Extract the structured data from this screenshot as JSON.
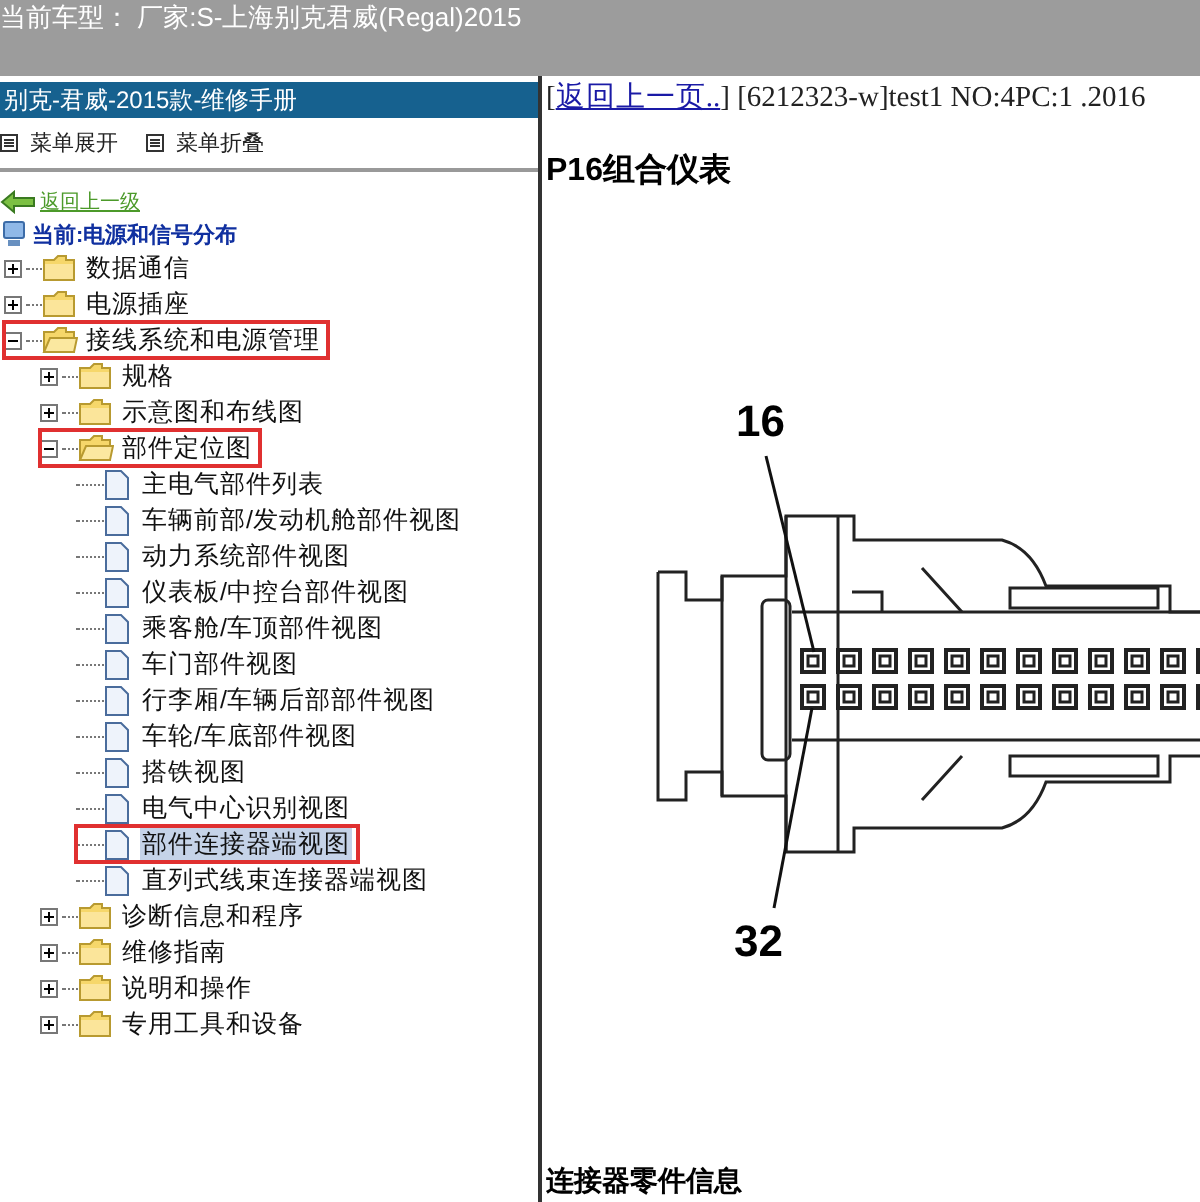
{
  "header": {
    "title": "当前车型： 厂家:S-上海别克君威(Regal)2015"
  },
  "sidebar": {
    "title": "别克-君威-2015款-维修手册",
    "menu_actions": [
      {
        "label": "菜单展开"
      },
      {
        "label": "菜单折叠"
      }
    ],
    "back_link": "返回上一级",
    "current": "当前:电源和信号分布",
    "tree": [
      {
        "label": "数据通信",
        "kind": "folder",
        "expanded": false,
        "selected": false,
        "highlighted": false
      },
      {
        "label": "电源插座",
        "kind": "folder",
        "expanded": false,
        "selected": false,
        "highlighted": false
      },
      {
        "label": "接线系统和电源管理",
        "kind": "folder",
        "expanded": true,
        "selected": false,
        "highlighted": true,
        "children": [
          {
            "label": "规格",
            "kind": "folder",
            "expanded": false,
            "selected": false,
            "highlighted": false
          },
          {
            "label": "示意图和布线图",
            "kind": "folder",
            "expanded": false,
            "selected": false,
            "highlighted": false
          },
          {
            "label": "部件定位图",
            "kind": "folder",
            "expanded": true,
            "selected": false,
            "highlighted": true,
            "children": [
              {
                "label": "主电气部件列表",
                "kind": "page",
                "selected": false,
                "highlighted": false
              },
              {
                "label": "车辆前部/发动机舱部件视图",
                "kind": "page",
                "selected": false,
                "highlighted": false
              },
              {
                "label": "动力系统部件视图",
                "kind": "page",
                "selected": false,
                "highlighted": false
              },
              {
                "label": "仪表板/中控台部件视图",
                "kind": "page",
                "selected": false,
                "highlighted": false
              },
              {
                "label": "乘客舱/车顶部件视图",
                "kind": "page",
                "selected": false,
                "highlighted": false
              },
              {
                "label": "车门部件视图",
                "kind": "page",
                "selected": false,
                "highlighted": false
              },
              {
                "label": "行李厢/车辆后部部件视图",
                "kind": "page",
                "selected": false,
                "highlighted": false
              },
              {
                "label": "车轮/车底部件视图",
                "kind": "page",
                "selected": false,
                "highlighted": false
              },
              {
                "label": "搭铁视图",
                "kind": "page",
                "selected": false,
                "highlighted": false
              },
              {
                "label": "电气中心识别视图",
                "kind": "page",
                "selected": false,
                "highlighted": false
              },
              {
                "label": "部件连接器端视图",
                "kind": "page",
                "selected": true,
                "highlighted": true
              },
              {
                "label": "直列式线束连接器端视图",
                "kind": "page",
                "selected": false,
                "highlighted": false
              }
            ]
          },
          {
            "label": "诊断信息和程序",
            "kind": "folder",
            "expanded": false,
            "selected": false,
            "highlighted": false
          },
          {
            "label": "维修指南",
            "kind": "folder",
            "expanded": false,
            "selected": false,
            "highlighted": false
          },
          {
            "label": "说明和操作",
            "kind": "folder",
            "expanded": false,
            "selected": false,
            "highlighted": false
          },
          {
            "label": "专用工具和设备",
            "kind": "folder",
            "expanded": false,
            "selected": false,
            "highlighted": false
          }
        ]
      }
    ]
  },
  "content": {
    "back_link_open": "[",
    "back_link": "返回上一页..",
    "back_link_close": "]",
    "doc_info": "[6212323-w]test1 NO:4PC:1 .2016",
    "heading": "P16组合仪表",
    "diagram": {
      "pin_labels": [
        "16",
        "32"
      ]
    },
    "section_heading": "连接器零件信息"
  }
}
